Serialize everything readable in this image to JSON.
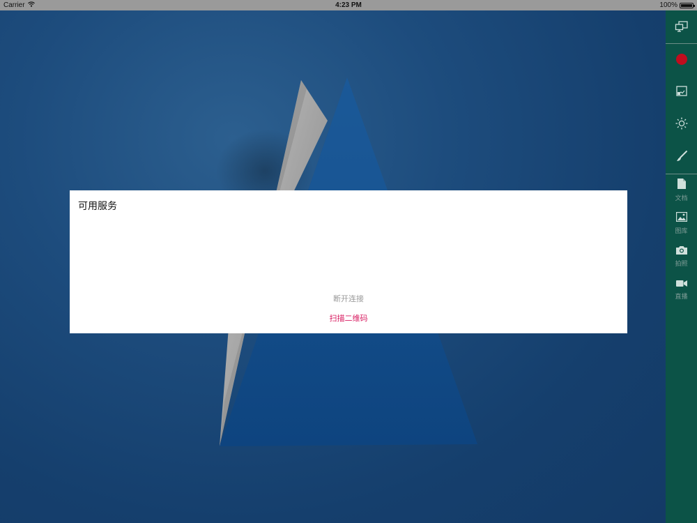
{
  "status_bar": {
    "carrier": "Carrier",
    "time": "4:23 PM",
    "battery": "100%",
    "battery_level": 1.0
  },
  "dialog": {
    "title": "可用服务",
    "disconnect_label": "断开连接",
    "scan_qr_label": "扫描二维码"
  },
  "sidebar": {
    "items": [
      {
        "icon": "screen-mirror-icon",
        "label": ""
      },
      {
        "icon": "record-icon",
        "label": ""
      },
      {
        "icon": "whiteboard-icon",
        "label": ""
      },
      {
        "icon": "brightness-icon",
        "label": ""
      },
      {
        "icon": "brush-icon",
        "label": ""
      },
      {
        "icon": "document-icon",
        "label": "文档"
      },
      {
        "icon": "gallery-icon",
        "label": "图库"
      },
      {
        "icon": "camera-icon",
        "label": "拍照"
      },
      {
        "icon": "video-icon",
        "label": "直播"
      }
    ]
  },
  "colors": {
    "sidebar_bg": "#0c5347",
    "record_red": "#c00d1e",
    "accent_pink": "#d81b60",
    "disabled_gray": "#9a9a9a"
  }
}
